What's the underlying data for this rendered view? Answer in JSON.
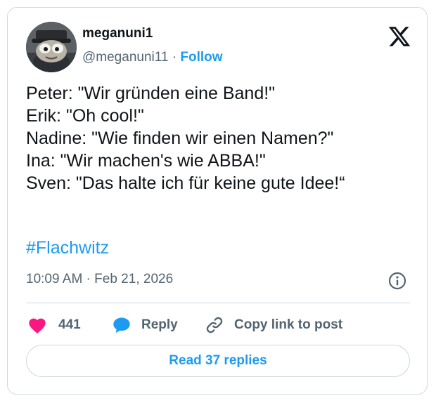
{
  "author": {
    "display_name": "meganuni1",
    "handle": "@meganuni11",
    "separator": " · ",
    "follow_label": "Follow",
    "avatar_icon": "avatar-cartoon-character"
  },
  "tweet": {
    "lines": [
      "Peter: \"Wir gründen eine Band!\"",
      "Erik: \"Oh cool!\"",
      "Nadine: \"Wie finden wir einen Namen?\"",
      "Ina: \"Wir machen's wie ABBA!\"",
      "Sven: \"Das halte ich für keine gute Idee!“"
    ],
    "hashtag": "#Flachwitz",
    "timestamp": "10:09 AM · Feb 21, 2026"
  },
  "actions": {
    "like_count": "441",
    "reply_label": "Reply",
    "copy_label": "Copy link to post"
  },
  "read_replies_label": "Read 37 replies",
  "icons": {
    "brand": "x-logo-icon",
    "info": "info-icon",
    "like": "heart-icon",
    "reply": "speech-bubble-icon",
    "copy": "link-icon"
  },
  "colors": {
    "text": "#0f1419",
    "secondary_text": "#536471",
    "accent": "#1d9bf0",
    "like": "#f91880",
    "border": "#cfd9de"
  }
}
